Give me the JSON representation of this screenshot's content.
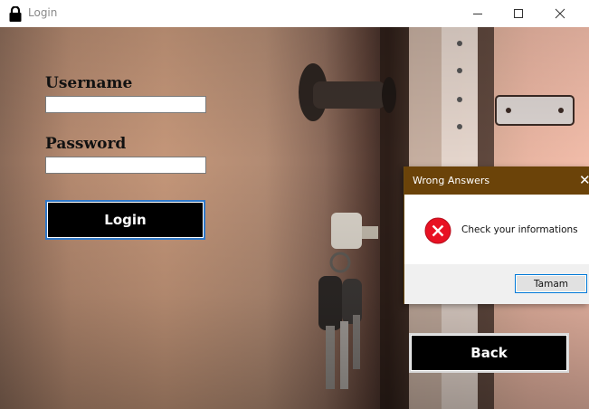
{
  "window": {
    "title": "Login",
    "title_icon": "lock-icon",
    "controls": [
      "minimize-icon",
      "maximize-icon",
      "close-icon"
    ]
  },
  "form": {
    "username_label": "Username",
    "username_value": "",
    "password_label": "Password",
    "password_value": "",
    "login_button": "Login",
    "back_button": "Back"
  },
  "dialog": {
    "title": "Wrong Answers",
    "close_glyph": "✕",
    "icon": "error-icon",
    "message": "Check your informations",
    "ok_button": "Tamam"
  },
  "colors": {
    "dialog_title_bar": "#6b4309",
    "button_fill": "#000000",
    "login_focus_border": "#2f78c8",
    "error_red": "#e81123",
    "dialog_button_border": "#0078d7"
  }
}
